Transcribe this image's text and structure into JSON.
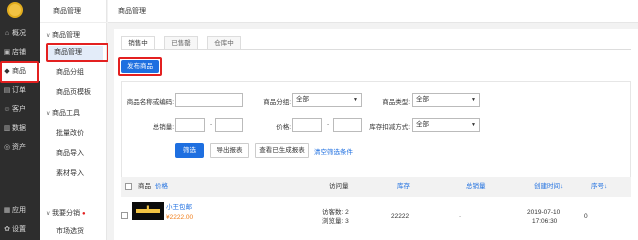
{
  "nav": {
    "items": [
      {
        "icon": "home-icon",
        "glyph": "⌂",
        "label": "概况"
      },
      {
        "icon": "store-icon",
        "glyph": "▣",
        "label": "店铺"
      },
      {
        "icon": "tag-icon",
        "glyph": "◆",
        "label": "商品"
      },
      {
        "icon": "order-icon",
        "glyph": "▤",
        "label": "订单"
      },
      {
        "icon": "customer-icon",
        "glyph": "☺",
        "label": "客户"
      },
      {
        "icon": "data-icon",
        "glyph": "▥",
        "label": "数据"
      },
      {
        "icon": "asset-icon",
        "glyph": "◎",
        "label": "资产"
      },
      {
        "icon": "apps-icon",
        "glyph": "▦",
        "label": "应用"
      },
      {
        "icon": "settings-icon",
        "glyph": "✿",
        "label": "设置"
      }
    ]
  },
  "sub": {
    "title": "商品管理",
    "groups": [
      {
        "label": "商品管理",
        "items": [
          "商品管理",
          "商品分组",
          "商品页模板"
        ]
      },
      {
        "label": "商品工具",
        "items": [
          "批量改价",
          "商品导入",
          "素材导入"
        ]
      },
      {
        "label": "我要分销",
        "items": [
          "市场选货"
        ]
      }
    ]
  },
  "main": {
    "header": "商品管理",
    "tabs": [
      "销售中",
      "已售罄",
      "仓库中"
    ],
    "publish_button": "发布商品",
    "filters": {
      "name_label": "商品名称或编码:",
      "group_label": "商品分组:",
      "group_value": "全部",
      "type_label": "商品类型:",
      "type_value": "全部",
      "sales_label": "总销量:",
      "price_label": "价格:",
      "stock_label": "库存扣减方式:",
      "stock_value": "全部",
      "range_sep": "-"
    },
    "actions": {
      "filter": "筛选",
      "export": "导出报表",
      "view_exports": "查看已生成报表",
      "clear": "清空筛选条件"
    },
    "table": {
      "headers": [
        "商品",
        "价格",
        "访问量",
        "库存",
        "总销量",
        "创建时间",
        "序号"
      ],
      "sort_arrow": "↓",
      "rows": [
        {
          "name": "小王包邮",
          "price": "¥2222.00",
          "visits": "访客数: 2",
          "views": "浏览量: 3",
          "stock": "22222",
          "sales": "-",
          "date": "2019-07-10",
          "time": "17:06:30",
          "order": "0"
        }
      ]
    }
  },
  "colors": {
    "nav_bg": "#2d2d2d",
    "primary": "#1e6fe0",
    "highlight": "#e32020",
    "price": "#f07e1b"
  }
}
